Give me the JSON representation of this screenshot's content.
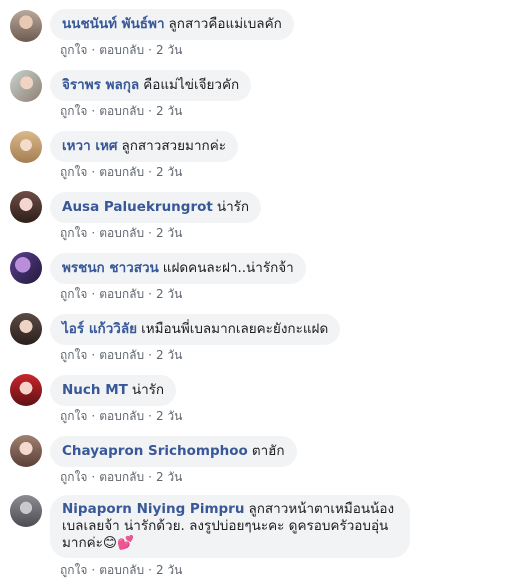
{
  "comments": [
    {
      "author": "นนชนันท์ พันธ์พา",
      "text": "ลูกสาวคือแม่เบลคัก",
      "like": "ถูกใจ",
      "reply": "ตอบกลับ",
      "sep": "·",
      "time": "2 วัน"
    },
    {
      "author": "จิราพร พลกุล",
      "text": "คือแม่ไข่เจียวคัก",
      "like": "ถูกใจ",
      "reply": "ตอบกลับ",
      "sep": "·",
      "time": "2 วัน"
    },
    {
      "author": "เหวา เหศ",
      "text": "ลูกสาวสวยมากค่ะ",
      "like": "ถูกใจ",
      "reply": "ตอบกลับ",
      "sep": "·",
      "time": "2 วัน"
    },
    {
      "author": "Ausa Paluekrungrot",
      "text": "น่ารัก",
      "like": "ถูกใจ",
      "reply": "ตอบกลับ",
      "sep": "·",
      "time": "2 วัน"
    },
    {
      "author": "พรชนก ชาวสวน",
      "text": "แฝดคนละฝา..น่ารักจ้า",
      "like": "ถูกใจ",
      "reply": "ตอบกลับ",
      "sep": "·",
      "time": "2 วัน"
    },
    {
      "author": "ไอร์ แก้ววิลัย",
      "text": "เหมือนพี่เบลมากเลยคะยังกะแฝด",
      "like": "ถูกใจ",
      "reply": "ตอบกลับ",
      "sep": "·",
      "time": "2 วัน"
    },
    {
      "author": "Nuch MT",
      "text": "น่ารัก",
      "like": "ถูกใจ",
      "reply": "ตอบกลับ",
      "sep": "·",
      "time": "2 วัน"
    },
    {
      "author": "Chayapron Srichomphoo",
      "text": "ตาฮัก",
      "like": "ถูกใจ",
      "reply": "ตอบกลับ",
      "sep": "·",
      "time": "2 วัน"
    },
    {
      "author": "Nipaporn Niying Pimpru",
      "text": "ลูกสาวหน้าตาเหมือนน้องเบลเลยจ้า น่ารักด้วย. ลงรูปบ่อยๆนะคะ ดูครอบครัวอบอุ่นมากค่ะ😊",
      "heart": "💕",
      "like": "ถูกใจ",
      "reply": "ตอบกลับ",
      "sep": "·",
      "time": "2 วัน"
    }
  ]
}
